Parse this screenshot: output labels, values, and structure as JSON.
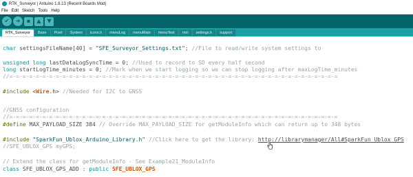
{
  "window": {
    "title": "RTK_Surveyor | Arduino 1.8.13 (Recent Boards Mod)"
  },
  "menu": [
    "File",
    "Edit",
    "Sketch",
    "Tools",
    "Help"
  ],
  "toolbar": {
    "buttons": [
      {
        "name": "verify-button",
        "icon": "check-icon",
        "glyph": "✔"
      },
      {
        "name": "upload-button",
        "icon": "arrow-right-icon",
        "glyph": "➜"
      },
      {
        "name": "new-button",
        "icon": "new-file-icon",
        "glyph": "▪"
      },
      {
        "name": "open-button",
        "icon": "arrow-up-icon",
        "glyph": "▲"
      },
      {
        "name": "save-button",
        "icon": "arrow-down-icon",
        "glyph": "▼"
      }
    ]
  },
  "tabs": [
    "RTK_Surveyor",
    "Base",
    "Pixel",
    "System",
    "icons.h",
    "menuLog",
    "menuMain",
    "menuTest",
    "nmi",
    "settings.h",
    "support"
  ],
  "active_tab": "RTK_Surveyor",
  "colors": {
    "toolbar": "#006468",
    "tabbar": "#17a1a5",
    "type_keyword": "#00979c",
    "preprocessor": "#5e6d03",
    "comment": "#95a5a6",
    "class_highlight": "#d35400"
  },
  "code": {
    "l1": {
      "a": "char",
      "b": " settingsFileName[40] = ",
      "c": "\"SFE_Surveyor_Settings.txt\"",
      "d": "; ",
      "e": "//File to read/write system settings to"
    },
    "l2": {
      "a": "unsigned",
      "b": " ",
      "c": "long",
      "d": " lastDataLogSyncTime = 0; ",
      "e": "//Used to record to SD every half second"
    },
    "l3": {
      "a": "long",
      "b": " startLogTime_minutes = 0; ",
      "c": "//Mark when we start logging so we can stop logging after maxLogTime_minutes"
    },
    "l4": {
      "a": "//=-=-=-=-=-=-=-=-=-=-=-=-=-=-=-=-=-=-=-=-=-=-=-=-=-=-=-=-=-=-=-=-=-=-=-=-=-=-=-=-=-=-=-=-=-=-=-=-=-="
    },
    "l5": {
      "a": "#include",
      "b": " <",
      "c": "Wire",
      "d": ".h> ",
      "e": "//Needed for I2C to GNSS"
    },
    "l6": {
      "a": "//GNSS configuration"
    },
    "l7": {
      "a": "//=-=-=-=-=-=-=-=-=-=-=-=-=-=-=-=-=-=-=-=-=-=-=-=-=-=-=-=-=-=-=-=-=-=-=-=-=-=-=-=-=-=-=-=-=-=-=-=-=-="
    },
    "l8": {
      "a": "#define",
      "b": " MAX_PAYLOAD_SIZE 384 ",
      "c": "// Override MAX_PAYLOAD_SIZE for getModuleInfo which can return up to 348 bytes"
    },
    "l9": {
      "a": "#include",
      "b": " ",
      "c": "\"SparkFun_Ublox_Arduino_Library.h\"",
      "d": " ",
      "e": "//Click here to get the library: ",
      "f": "http://librarymanager/All#SparkFun_Ublox_GPS"
    },
    "l10": {
      "a": "//SFE_UBLOX_GPS myGPS;"
    },
    "l11": {
      "a": "// Extend the class for getModuleInfo - See Example21_ModuleInfo"
    },
    "l12": {
      "a": "class",
      "b": " SFE_UBLOX_GPS_ADD : ",
      "c": "public",
      "d": " ",
      "e": "SFE_UBLOX_GPS"
    }
  }
}
